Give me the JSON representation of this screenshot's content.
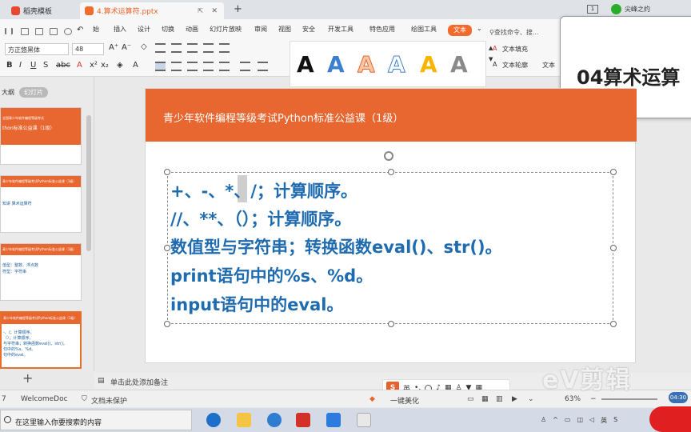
{
  "tabs": {
    "inactive": "稻壳模板",
    "active": "4.算术运算符.pptx",
    "add": "+",
    "window_count": "1",
    "user": "尖峰之约"
  },
  "menu": {
    "items": [
      "始",
      "插入",
      "设计",
      "切换",
      "动画",
      "幻灯片放映",
      "审阅",
      "视图",
      "安全",
      "开发工具",
      "特色应用",
      "绘图工具"
    ],
    "highlighted": "文本",
    "search_command": "查找命令、搜..."
  },
  "format": {
    "font_name": "方正悠黑体",
    "font_size": "48",
    "text_fill": "文本填充",
    "text_outline": "文本轮廓",
    "text_effect": "文本"
  },
  "floating_card": {
    "title": "04算术运算"
  },
  "left_panel": {
    "outline_label": "大纲",
    "slides_label": "幻灯片",
    "add_slide": "+",
    "thumbnails": [
      {
        "header": "全国青少年软件编程等级考试",
        "line1": "thon标准公益课（1级）"
      },
      {
        "header": "青少年软件编程等级考试Python标准公益课（1级）",
        "line1": "知讲 算术运算符"
      },
      {
        "header": "青少年软件编程等级考试Python标准公益课（1级）",
        "line1": "值型：整数、浮点数",
        "line2": "符型：字符串"
      },
      {
        "header": "青少年软件编程等级考试Python标准公益课（1级）",
        "line1": "-、/；计算顺序。",
        "line2": "（）；计算顺序。",
        "line3": "与字符串；转换函数eval()、str()。",
        "line4": "句中的%s、%d。",
        "line5": "句中的eval。"
      }
    ]
  },
  "slide": {
    "title": "青少年软件编程等级考试Python标准公益课（1级）",
    "lines": [
      "+、-、*、/；计算顺序。",
      "//、**、（）；计算顺序。",
      "数值型与字符串；转换函数eval()、str()。",
      "print语句中的%s、%d。",
      "input语句中的eval。"
    ]
  },
  "notes": {
    "placeholder": "单击此处添加备注"
  },
  "statusbar": {
    "slide_info": "7",
    "theme": "WelcomeDoc",
    "doc_protect": "文档未保护",
    "beautify": "一键美化",
    "zoom": "63%"
  },
  "ime": {
    "lang": "英"
  },
  "watermark": {
    "text": "eV剪辑",
    "time": "04:30"
  },
  "taskbar": {
    "search_placeholder": "在这里输入你要搜索的内容"
  }
}
